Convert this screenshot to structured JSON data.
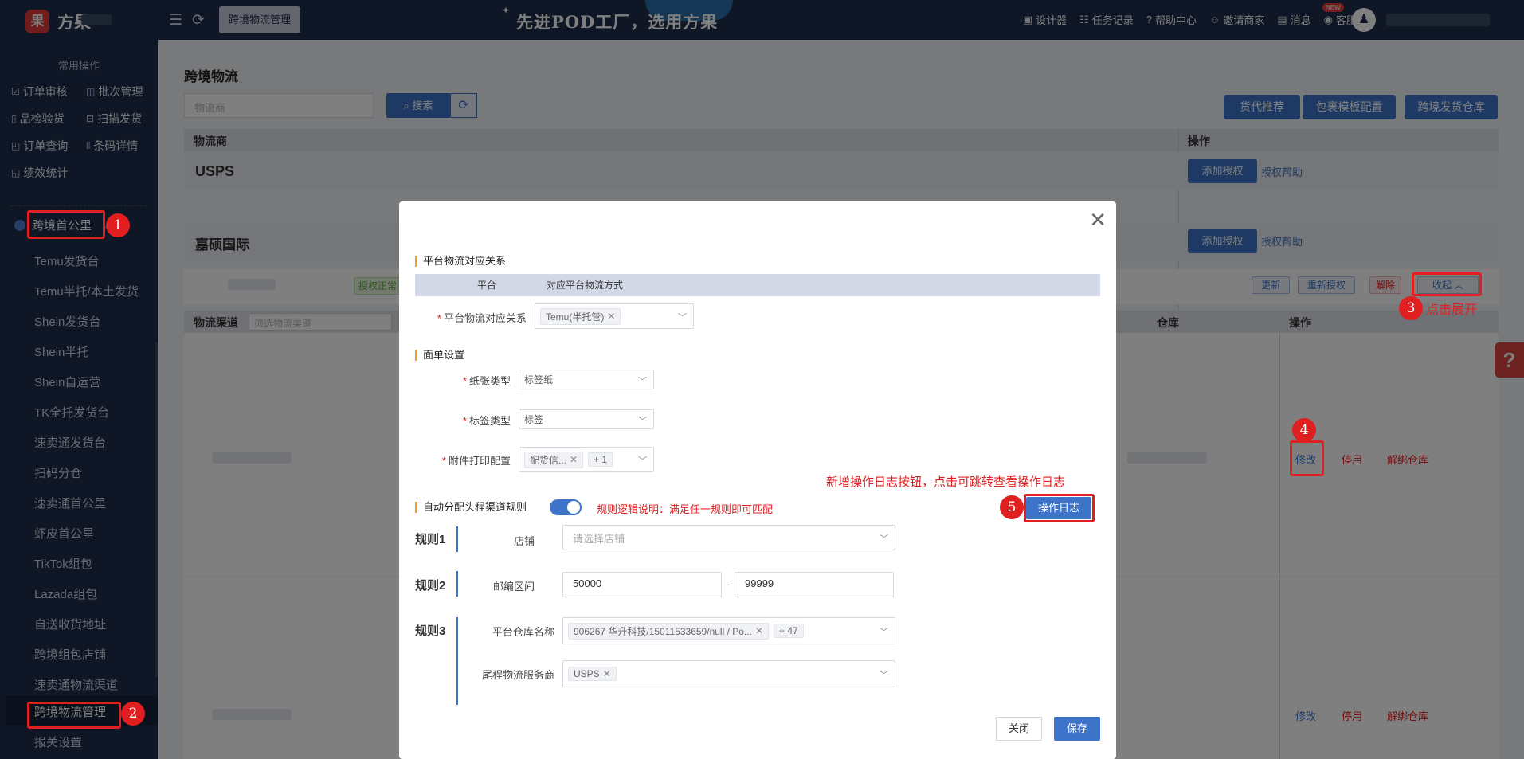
{
  "topbar": {
    "logo_text": "方果",
    "current_tag": "跨境物流管理",
    "slogan": "先进POD工厂，选用方果",
    "menu": [
      {
        "icon": "image-icon",
        "label": "设计器"
      },
      {
        "icon": "list-icon",
        "label": "任务记录"
      },
      {
        "icon": "help-icon",
        "label": "帮助中心"
      },
      {
        "icon": "invite-icon",
        "label": "邀请商家"
      },
      {
        "icon": "message-icon",
        "label": "消息"
      },
      {
        "icon": "headset-icon",
        "label": "客服"
      }
    ],
    "new_badge": "NEW"
  },
  "sidebar": {
    "heading": "常用操作",
    "quick_actions": [
      "订单审核",
      "批次管理",
      "品检验货",
      "扫描发货",
      "订单查询",
      "条码详情",
      "绩效统计"
    ],
    "group_label": "跨境首公里",
    "items": [
      "Temu发货台",
      "Temu半托/本土发货",
      "Shein发货台",
      "Shein半托",
      "Shein自运营",
      "TK全托发货台",
      "速卖通发货台",
      "扫码分仓",
      "速卖通首公里",
      "虾皮首公里",
      "TikTok组包",
      "Lazada组包",
      "自送收货地址",
      "跨境组包店铺",
      "速卖通物流渠道",
      "跨境物流管理",
      "报关设置"
    ],
    "active_item": "跨境物流管理"
  },
  "main": {
    "title": "跨境物流",
    "search_placeholder": "物流商",
    "search_btn": "搜索",
    "top_buttons": [
      "货代推荐",
      "包裹模板配置",
      "跨境发货仓库"
    ],
    "table_headers": {
      "carrier": "物流商",
      "ops": "操作"
    },
    "carriers": [
      {
        "name": "USPS",
        "add_auth": "添加授权",
        "auth_help": "授权帮助"
      },
      {
        "name": "嘉硕国际",
        "add_auth": "添加授权",
        "auth_help": "授权帮助"
      }
    ],
    "auth_status": "授权正常",
    "account_buttons": [
      "更新",
      "重新授权",
      "解除",
      "收起"
    ],
    "channel_header": "物流渠道",
    "channel_filter_placeholder": "筛选物流渠道",
    "warehouse_header": "仓库",
    "ops_header": "操作",
    "row_ops": [
      "修改",
      "停用",
      "解绑仓库"
    ]
  },
  "annotations": {
    "badges": [
      "1",
      "2",
      "3",
      "4",
      "5"
    ],
    "note3": "点击展开",
    "new_feature_note": "新增操作日志按钮，点击可跳转查看操作日志"
  },
  "modal": {
    "section_mapping": "平台物流对应关系",
    "mapping_headers": [
      "平台",
      "对应平台物流方式"
    ],
    "mapping_label": "平台物流对应关系",
    "mapping_tag": "Temu(半托管)",
    "section_label": "面单设置",
    "paper_type_label": "纸张类型",
    "paper_type_value": "标签纸",
    "label_type_label": "标签类型",
    "label_type_value": "标签",
    "attach_label": "附件打印配置",
    "attach_tag": "配货信...",
    "attach_more": "+ 1",
    "section_auto": "自动分配头程渠道规则",
    "rule_note": "规则逻辑说明：满足任一规则即可匹配",
    "oplog_btn": "操作日志",
    "rule1": {
      "title": "规则1",
      "field": "店铺",
      "placeholder": "请选择店铺"
    },
    "rule2": {
      "title": "规则2",
      "field": "邮编区间",
      "from": "50000",
      "sep": "-",
      "to": "99999"
    },
    "rule3": {
      "title": "规则3",
      "field_wh": "平台仓库名称",
      "wh_tag": "906267 华升科技/15011533659/null / Po...",
      "wh_more": "+ 47",
      "field_carrier": "尾程物流服务商",
      "carrier_tag": "USPS"
    },
    "close_btn": "关闭",
    "save_btn": "保存"
  }
}
